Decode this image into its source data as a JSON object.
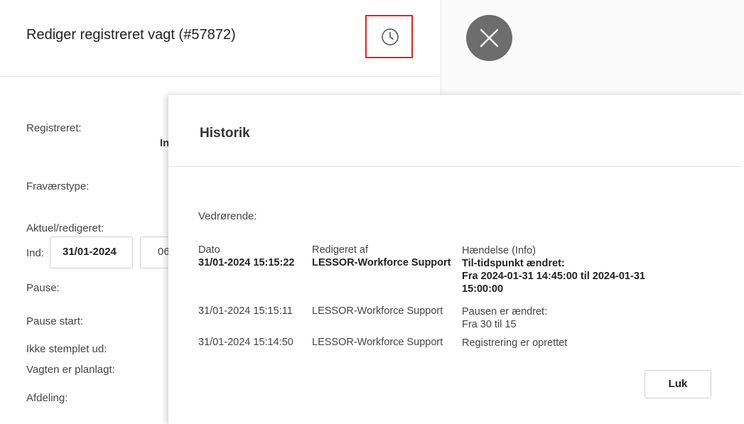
{
  "edit_dialog": {
    "title": "Rediger registreret vagt (#57872)",
    "history_icon": "clock-icon",
    "close_icon": "close-icon",
    "labels": {
      "registered": "Registreret:",
      "absence_type": "Fraværstype:",
      "actual_edited": "Aktuel/redigeret:",
      "in": "Ind:",
      "pause": "Pause:",
      "pause_start": "Pause start:",
      "not_clocked_out": "Ikke stemplet ud:",
      "shift_planned": "Vagten er planlagt:",
      "department": "Afdeling:"
    },
    "registered_value_partial": "In",
    "in_date": "31/01-2024",
    "in_time_partial": "06"
  },
  "history": {
    "title": "Historik",
    "concerning_label": "Vedrørende:",
    "columns": [
      "Dato",
      "Redigeret af",
      "Hændelse (Info)"
    ],
    "rows": [
      {
        "date": "31/01-2024 15:15:22",
        "edited_by": "LESSOR-Workforce Support",
        "event": "Til-tidspunkt ændret:",
        "info": "Fra 2024-01-31 14:45:00 til 2024-01-31 15:00:00",
        "bold": true
      },
      {
        "date": "31/01-2024 15:15:11",
        "edited_by": "LESSOR-Workforce Support",
        "event": "Pausen er ændret:",
        "info": "Fra 30 til 15",
        "bold": false
      },
      {
        "date": "31/01-2024 15:14:50",
        "edited_by": "LESSOR-Workforce Support",
        "event": "Registrering er oprettet",
        "info": "",
        "bold": false
      }
    ],
    "close_label": "Luk"
  }
}
